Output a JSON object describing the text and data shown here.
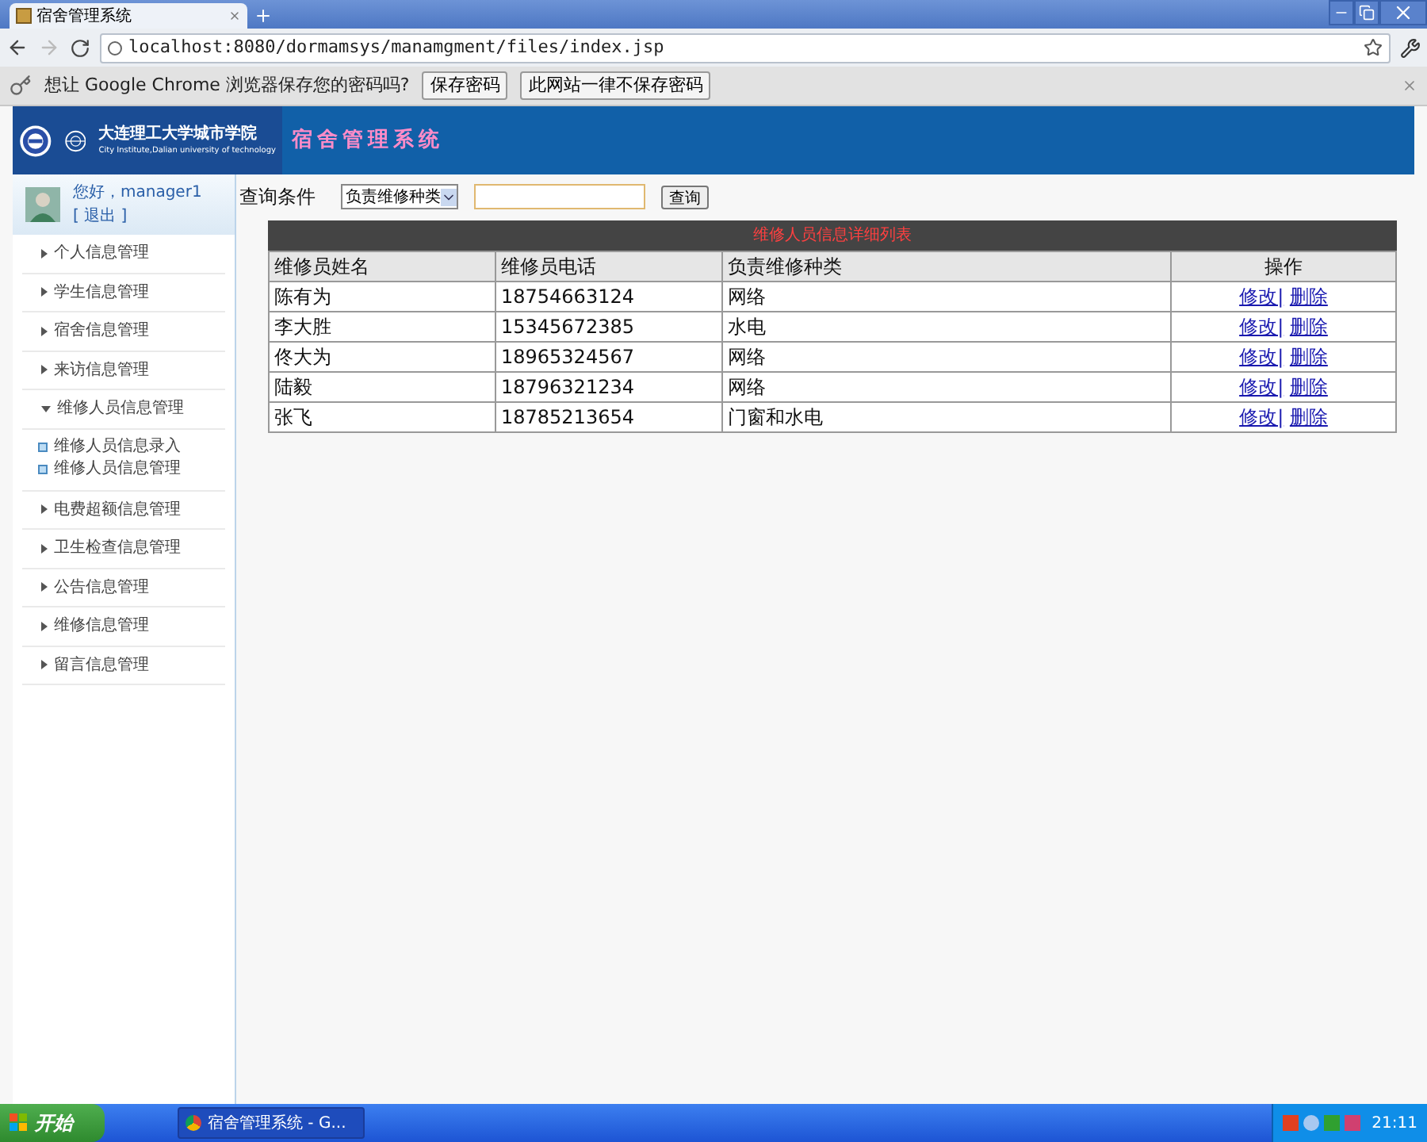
{
  "browser": {
    "tab_title": "宿舍管理系统",
    "address": "localhost:8080/dormamsys/manamgment/files/index.jsp"
  },
  "password_bar": {
    "message": "想让 Google Chrome 浏览器保存您的密码吗?",
    "buttons": [
      "保存密码",
      "此网站一律不保存密码"
    ]
  },
  "header": {
    "school_name": "大连理工大学城市学院",
    "school_name_en": "City Institute,Dalian university of technology",
    "system_title": "宿舍管理系统"
  },
  "user": {
    "greeting": "您好，manager1",
    "logout": "[ 退出 ]"
  },
  "sidebar": {
    "items": [
      {
        "label": "个人信息管理",
        "expanded": false
      },
      {
        "label": "学生信息管理",
        "expanded": false
      },
      {
        "label": "宿舍信息管理",
        "expanded": false
      },
      {
        "label": "来访信息管理",
        "expanded": false
      },
      {
        "label": "维修人员信息管理",
        "expanded": true,
        "children": [
          {
            "label": "维修人员信息录入"
          },
          {
            "label": "维修人员信息管理"
          }
        ]
      },
      {
        "label": "电费超额信息管理",
        "expanded": false
      },
      {
        "label": "卫生检查信息管理",
        "expanded": false
      },
      {
        "label": "公告信息管理",
        "expanded": false
      },
      {
        "label": "维修信息管理",
        "expanded": false
      },
      {
        "label": "留言信息管理",
        "expanded": false
      }
    ]
  },
  "search": {
    "label": "查询条件",
    "select_value": "负责维修种类",
    "button": "查询"
  },
  "table": {
    "title": "维修人员信息详细列表",
    "columns": [
      "维修员姓名",
      "维修员电话",
      "负责维修种类",
      "操作"
    ],
    "rows": [
      {
        "name": "陈有为",
        "phone": "18754663124",
        "type": "网络",
        "edit": "修改|",
        "delete": "删除"
      },
      {
        "name": "李大胜",
        "phone": "15345672385",
        "type": "水电",
        "edit": "修改|",
        "delete": "删除"
      },
      {
        "name": "佟大为",
        "phone": "18965324567",
        "type": "网络",
        "edit": "修改|",
        "delete": "删除"
      },
      {
        "name": "陆毅",
        "phone": "18796321234",
        "type": "网络",
        "edit": "修改|",
        "delete": "删除"
      },
      {
        "name": "张飞",
        "phone": "18785213654",
        "type": "门窗和水电",
        "edit": "修改|",
        "delete": "删除"
      }
    ]
  },
  "taskbar": {
    "start": "开始",
    "task": "宿舍管理系统 - G...",
    "clock": "21:11"
  }
}
